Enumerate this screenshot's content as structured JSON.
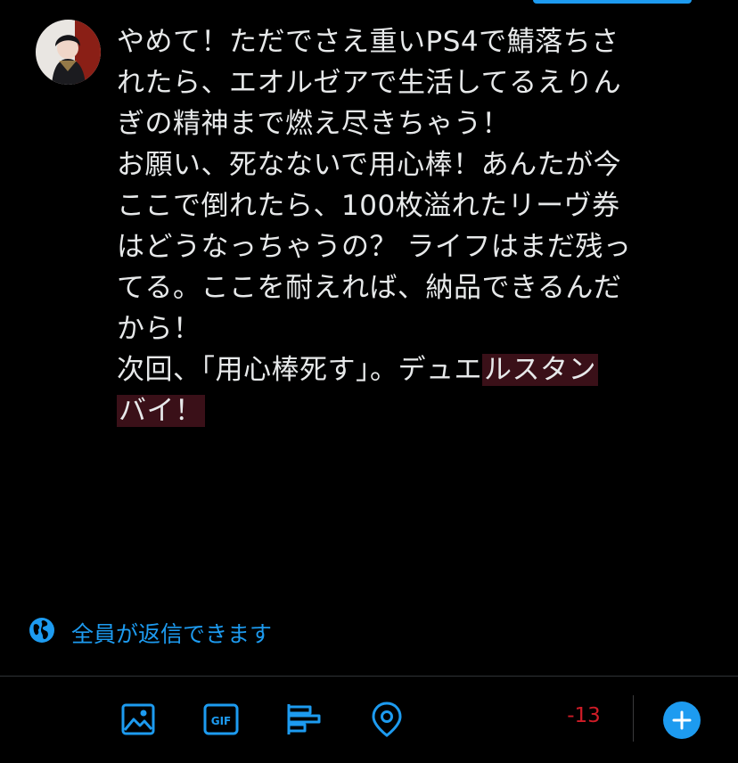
{
  "compose": {
    "lines_plain": [
      "やめて！ただでさえ重いPS4で鯖落ちさ",
      "れたら、エオルゼアで生活してるえりん",
      "ぎの精神まで燃え尽きちゃう！",
      "お願い、死なないで用心棒！あんたが今",
      "ここで倒れたら、100枚溢れたリーヴ券",
      "はどうなっちゃうの？ ライフはまだ残っ",
      "てる。ここを耐えれば、納品できるんだ",
      "から！"
    ],
    "line9_normal": "次回、「用心棒死す」。デュエ",
    "line9_overflow": "ルスタン",
    "line10_overflow": "バイ！"
  },
  "reply_setting": {
    "label": "全員が返信できます",
    "icon": "globe-icon"
  },
  "toolbar": {
    "icons": [
      "audio-space-icon",
      "image-icon",
      "gif-icon",
      "poll-icon",
      "location-icon"
    ],
    "gif_label": "GIF",
    "char_counter": "-13",
    "add_icon": "plus-icon"
  },
  "colors": {
    "accent": "#1d9bf0",
    "background": "#000000",
    "text": "#e7e9ea",
    "overflow_highlight": "#3a1018",
    "counter_over_limit": "#f4212e",
    "audio_space": "#a45cf5"
  }
}
